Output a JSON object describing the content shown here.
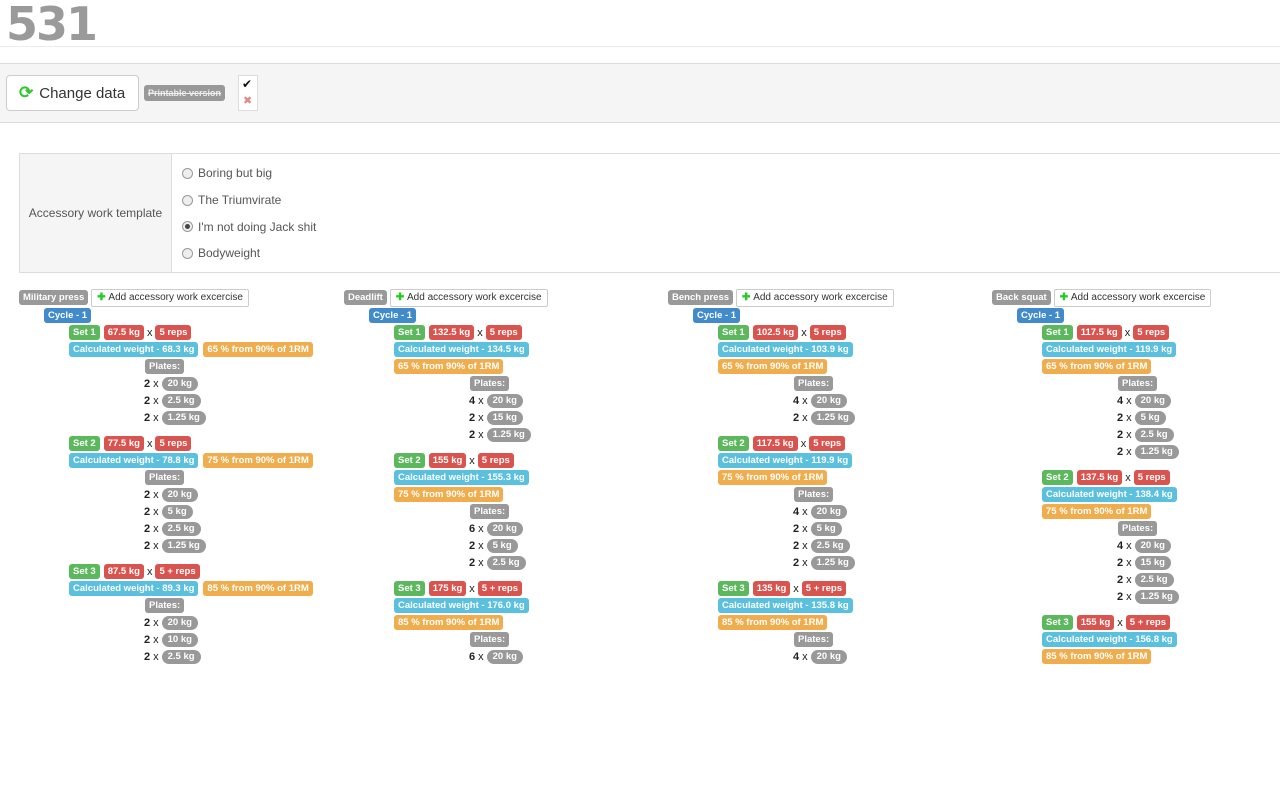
{
  "logo": {
    "text": "531"
  },
  "toolbar": {
    "change_data_label": "Change data",
    "printable_label": "Printable version",
    "toggle_on": "✔",
    "toggle_off": "✖"
  },
  "accessory": {
    "label": "Accessory work template",
    "options": [
      "Boring but big",
      "The Triumvirate",
      "I'm not doing Jack shit",
      "Bodyweight"
    ],
    "selected": "I'm not doing Jack shit"
  },
  "add_label": "Add accessory work excercise",
  "exercises": [
    {
      "name": "Military press",
      "cycle": "Cycle - 1",
      "sets": [
        {
          "set": "Set 1",
          "weight": "67.5 kg",
          "reps": "5 reps",
          "calc": "Calculated weight - 68.3 kg",
          "pct": "65 % from 90% of 1RM",
          "plates": [
            [
              "2",
              "20 kg"
            ],
            [
              "2",
              "2.5 kg"
            ],
            [
              "2",
              "1.25 kg"
            ]
          ]
        },
        {
          "set": "Set 2",
          "weight": "77.5 kg",
          "reps": "5 reps",
          "calc": "Calculated weight - 78.8 kg",
          "pct": "75 % from 90% of 1RM",
          "plates": [
            [
              "2",
              "20 kg"
            ],
            [
              "2",
              "5 kg"
            ],
            [
              "2",
              "2.5 kg"
            ],
            [
              "2",
              "1.25 kg"
            ]
          ]
        },
        {
          "set": "Set 3",
          "weight": "87.5 kg",
          "reps": "5 + reps",
          "calc": "Calculated weight - 89.3 kg",
          "pct": "85 % from 90% of 1RM",
          "plates": [
            [
              "2",
              "20 kg"
            ],
            [
              "2",
              "10 kg"
            ],
            [
              "2",
              "2.5 kg"
            ]
          ]
        }
      ]
    },
    {
      "name": "Deadlift",
      "cycle": "Cycle - 1",
      "sets": [
        {
          "set": "Set 1",
          "weight": "132.5 kg",
          "reps": "5 reps",
          "calc": "Calculated weight - 134.5 kg",
          "pct": "65 % from 90% of 1RM",
          "plates": [
            [
              "4",
              "20 kg"
            ],
            [
              "2",
              "15 kg"
            ],
            [
              "2",
              "1.25 kg"
            ]
          ]
        },
        {
          "set": "Set 2",
          "weight": "155 kg",
          "reps": "5 reps",
          "calc": "Calculated weight - 155.3 kg",
          "pct": "75 % from 90% of 1RM",
          "plates": [
            [
              "6",
              "20 kg"
            ],
            [
              "2",
              "5 kg"
            ],
            [
              "2",
              "2.5 kg"
            ]
          ]
        },
        {
          "set": "Set 3",
          "weight": "175 kg",
          "reps": "5 + reps",
          "calc": "Calculated weight - 176.0 kg",
          "pct": "85 % from 90% of 1RM",
          "plates": [
            [
              "6",
              "20 kg"
            ]
          ]
        }
      ]
    },
    {
      "name": "Bench press",
      "cycle": "Cycle - 1",
      "sets": [
        {
          "set": "Set 1",
          "weight": "102.5 kg",
          "reps": "5 reps",
          "calc": "Calculated weight - 103.9 kg",
          "pct": "65 % from 90% of 1RM",
          "plates": [
            [
              "4",
              "20 kg"
            ],
            [
              "2",
              "1.25 kg"
            ]
          ]
        },
        {
          "set": "Set 2",
          "weight": "117.5 kg",
          "reps": "5 reps",
          "calc": "Calculated weight - 119.9 kg",
          "pct": "75 % from 90% of 1RM",
          "plates": [
            [
              "4",
              "20 kg"
            ],
            [
              "2",
              "5 kg"
            ],
            [
              "2",
              "2.5 kg"
            ],
            [
              "2",
              "1.25 kg"
            ]
          ]
        },
        {
          "set": "Set 3",
          "weight": "135 kg",
          "reps": "5 + reps",
          "calc": "Calculated weight - 135.8 kg",
          "pct": "85 % from 90% of 1RM",
          "plates": [
            [
              "4",
              "20 kg"
            ]
          ]
        }
      ]
    },
    {
      "name": "Back squat",
      "cycle": "Cycle - 1",
      "sets": [
        {
          "set": "Set 1",
          "weight": "117.5 kg",
          "reps": "5 reps",
          "calc": "Calculated weight - 119.9 kg",
          "pct": "65 % from 90% of 1RM",
          "plates": [
            [
              "4",
              "20 kg"
            ],
            [
              "2",
              "5 kg"
            ],
            [
              "2",
              "2.5 kg"
            ],
            [
              "2",
              "1.25 kg"
            ]
          ]
        },
        {
          "set": "Set 2",
          "weight": "137.5 kg",
          "reps": "5 reps",
          "calc": "Calculated weight - 138.4 kg",
          "pct": "75 % from 90% of 1RM",
          "plates": [
            [
              "4",
              "20 kg"
            ],
            [
              "2",
              "15 kg"
            ],
            [
              "2",
              "2.5 kg"
            ],
            [
              "2",
              "1.25 kg"
            ]
          ]
        },
        {
          "set": "Set 3",
          "weight": "155 kg",
          "reps": "5 + reps",
          "calc": "Calculated weight - 156.8 kg",
          "pct": "85 % from 90% of 1RM",
          "plates": []
        }
      ]
    }
  ],
  "plates_label": "Plates:",
  "times": "x"
}
